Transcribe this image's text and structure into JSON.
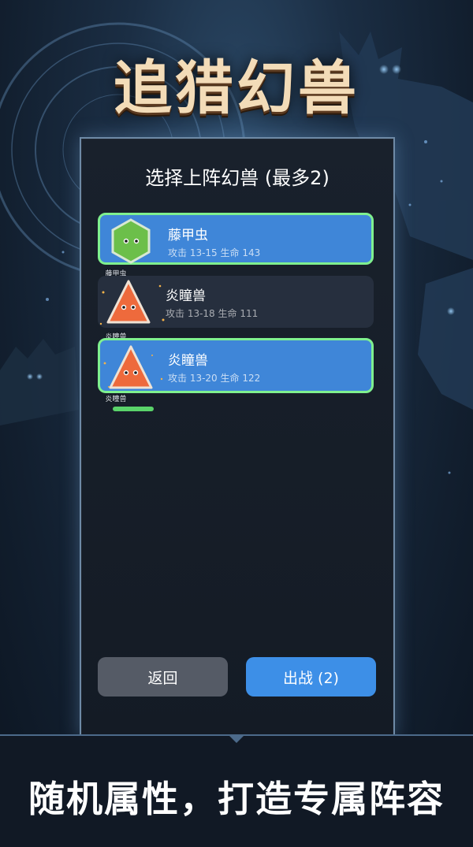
{
  "title": "追猎幻兽",
  "panel": {
    "heading": "选择上阵幻兽 (最多2)",
    "beasts": [
      {
        "name": "藤甲虫",
        "stats": "攻击 13-15   生命 143",
        "label": "藤甲虫",
        "selected": true,
        "shape": "hexagon",
        "color": "#6cbf4a"
      },
      {
        "name": "炎瞳兽",
        "stats": "攻击 13-18   生命 111",
        "label": "炎瞳兽",
        "selected": false,
        "shape": "triangle",
        "color": "#ee6a3c"
      },
      {
        "name": "炎瞳兽",
        "stats": "攻击 13-20   生命 122",
        "label": "炎瞳兽",
        "selected": true,
        "shape": "triangle",
        "color": "#ee6a3c"
      }
    ],
    "back_label": "返回",
    "battle_label": "出战 (2)"
  },
  "banner": {
    "text": "随机属性，打造专属阵容"
  },
  "colors": {
    "selected_card": "#3f86d8",
    "selected_border": "#7ff08f",
    "battle_button": "#3d8fe7",
    "back_button": "#555b66"
  }
}
